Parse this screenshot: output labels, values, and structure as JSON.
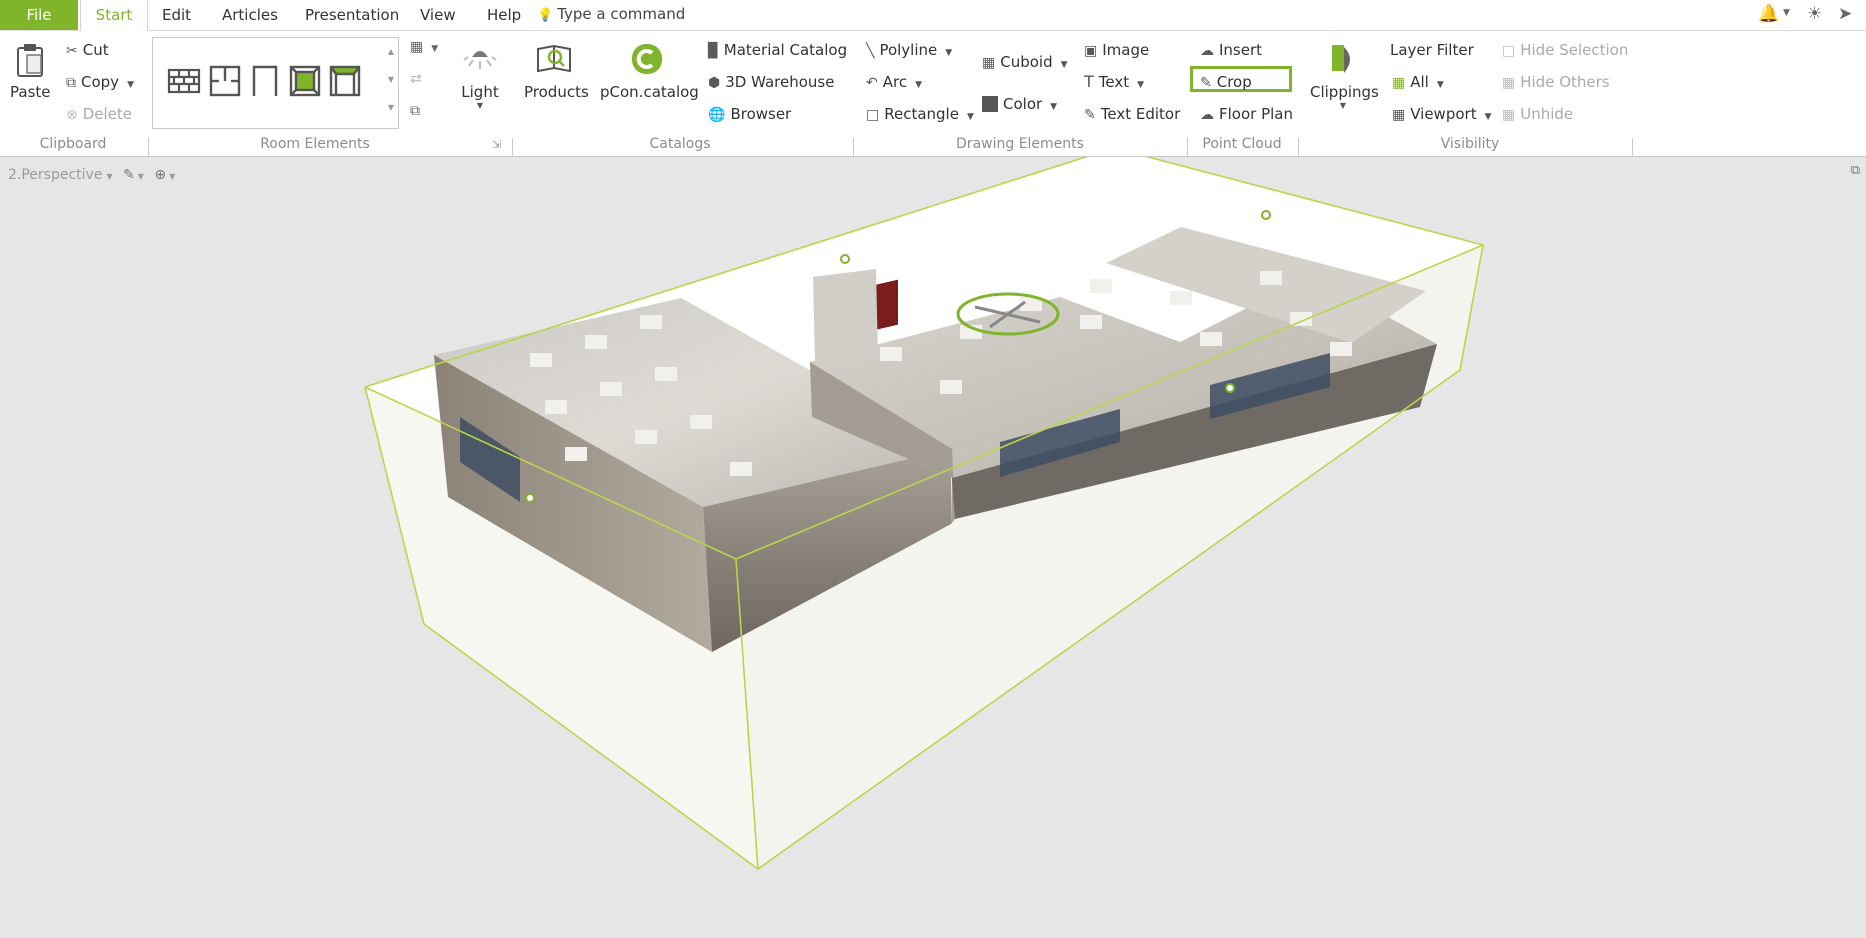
{
  "menu": {
    "file": "File",
    "tabs": [
      "Start",
      "Edit",
      "Articles",
      "Presentation",
      "View",
      "Help"
    ],
    "command_placeholder": "Type a command"
  },
  "clipboard": {
    "paste": "Paste",
    "cut": "Cut",
    "copy": "Copy",
    "delete": "Delete",
    "label": "Clipboard"
  },
  "room_elements": {
    "label": "Room Elements"
  },
  "light": {
    "label": "Light"
  },
  "catalogs": {
    "products": "Products",
    "pcon": "pCon.catalog",
    "material": "Material Catalog",
    "warehouse": "3D Warehouse",
    "browser": "Browser",
    "label": "Catalogs"
  },
  "drawing": {
    "polyline": "Polyline",
    "arc": "Arc",
    "rectangle": "Rectangle",
    "cuboid": "Cuboid",
    "color": "Color",
    "image": "Image",
    "text": "Text",
    "text_editor": "Text Editor",
    "label": "Drawing Elements"
  },
  "point_cloud": {
    "insert": "Insert",
    "crop": "Crop",
    "floor_plan": "Floor Plan",
    "label": "Point Cloud"
  },
  "visibility": {
    "clippings": "Clippings",
    "layer_filter": "Layer Filter",
    "all": "All",
    "viewport": "Viewport",
    "hide_selection": "Hide Selection",
    "hide_others": "Hide Others",
    "unhide": "Unhide",
    "label": "Visibility"
  },
  "viewport_label": "2.Perspective",
  "colors": {
    "accent": "#7fb42b",
    "bbox": "#b9d64a"
  }
}
